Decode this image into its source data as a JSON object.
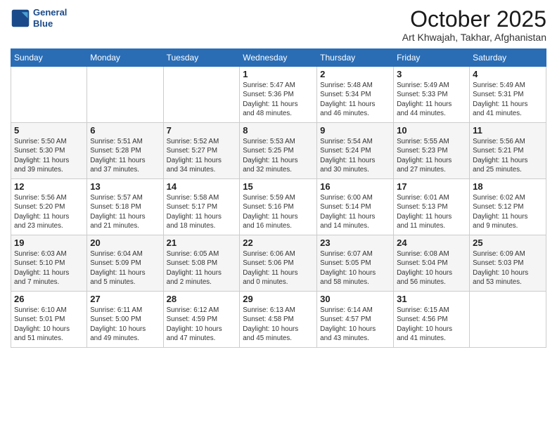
{
  "header": {
    "logo_line1": "General",
    "logo_line2": "Blue",
    "title": "October 2025",
    "location": "Art Khwajah, Takhar, Afghanistan"
  },
  "days_of_week": [
    "Sunday",
    "Monday",
    "Tuesday",
    "Wednesday",
    "Thursday",
    "Friday",
    "Saturday"
  ],
  "weeks": [
    [
      {
        "day": "",
        "info": ""
      },
      {
        "day": "",
        "info": ""
      },
      {
        "day": "",
        "info": ""
      },
      {
        "day": "1",
        "info": "Sunrise: 5:47 AM\nSunset: 5:36 PM\nDaylight: 11 hours\nand 48 minutes."
      },
      {
        "day": "2",
        "info": "Sunrise: 5:48 AM\nSunset: 5:34 PM\nDaylight: 11 hours\nand 46 minutes."
      },
      {
        "day": "3",
        "info": "Sunrise: 5:49 AM\nSunset: 5:33 PM\nDaylight: 11 hours\nand 44 minutes."
      },
      {
        "day": "4",
        "info": "Sunrise: 5:49 AM\nSunset: 5:31 PM\nDaylight: 11 hours\nand 41 minutes."
      }
    ],
    [
      {
        "day": "5",
        "info": "Sunrise: 5:50 AM\nSunset: 5:30 PM\nDaylight: 11 hours\nand 39 minutes."
      },
      {
        "day": "6",
        "info": "Sunrise: 5:51 AM\nSunset: 5:28 PM\nDaylight: 11 hours\nand 37 minutes."
      },
      {
        "day": "7",
        "info": "Sunrise: 5:52 AM\nSunset: 5:27 PM\nDaylight: 11 hours\nand 34 minutes."
      },
      {
        "day": "8",
        "info": "Sunrise: 5:53 AM\nSunset: 5:25 PM\nDaylight: 11 hours\nand 32 minutes."
      },
      {
        "day": "9",
        "info": "Sunrise: 5:54 AM\nSunset: 5:24 PM\nDaylight: 11 hours\nand 30 minutes."
      },
      {
        "day": "10",
        "info": "Sunrise: 5:55 AM\nSunset: 5:23 PM\nDaylight: 11 hours\nand 27 minutes."
      },
      {
        "day": "11",
        "info": "Sunrise: 5:56 AM\nSunset: 5:21 PM\nDaylight: 11 hours\nand 25 minutes."
      }
    ],
    [
      {
        "day": "12",
        "info": "Sunrise: 5:56 AM\nSunset: 5:20 PM\nDaylight: 11 hours\nand 23 minutes."
      },
      {
        "day": "13",
        "info": "Sunrise: 5:57 AM\nSunset: 5:18 PM\nDaylight: 11 hours\nand 21 minutes."
      },
      {
        "day": "14",
        "info": "Sunrise: 5:58 AM\nSunset: 5:17 PM\nDaylight: 11 hours\nand 18 minutes."
      },
      {
        "day": "15",
        "info": "Sunrise: 5:59 AM\nSunset: 5:16 PM\nDaylight: 11 hours\nand 16 minutes."
      },
      {
        "day": "16",
        "info": "Sunrise: 6:00 AM\nSunset: 5:14 PM\nDaylight: 11 hours\nand 14 minutes."
      },
      {
        "day": "17",
        "info": "Sunrise: 6:01 AM\nSunset: 5:13 PM\nDaylight: 11 hours\nand 11 minutes."
      },
      {
        "day": "18",
        "info": "Sunrise: 6:02 AM\nSunset: 5:12 PM\nDaylight: 11 hours\nand 9 minutes."
      }
    ],
    [
      {
        "day": "19",
        "info": "Sunrise: 6:03 AM\nSunset: 5:10 PM\nDaylight: 11 hours\nand 7 minutes."
      },
      {
        "day": "20",
        "info": "Sunrise: 6:04 AM\nSunset: 5:09 PM\nDaylight: 11 hours\nand 5 minutes."
      },
      {
        "day": "21",
        "info": "Sunrise: 6:05 AM\nSunset: 5:08 PM\nDaylight: 11 hours\nand 2 minutes."
      },
      {
        "day": "22",
        "info": "Sunrise: 6:06 AM\nSunset: 5:06 PM\nDaylight: 11 hours\nand 0 minutes."
      },
      {
        "day": "23",
        "info": "Sunrise: 6:07 AM\nSunset: 5:05 PM\nDaylight: 10 hours\nand 58 minutes."
      },
      {
        "day": "24",
        "info": "Sunrise: 6:08 AM\nSunset: 5:04 PM\nDaylight: 10 hours\nand 56 minutes."
      },
      {
        "day": "25",
        "info": "Sunrise: 6:09 AM\nSunset: 5:03 PM\nDaylight: 10 hours\nand 53 minutes."
      }
    ],
    [
      {
        "day": "26",
        "info": "Sunrise: 6:10 AM\nSunset: 5:01 PM\nDaylight: 10 hours\nand 51 minutes."
      },
      {
        "day": "27",
        "info": "Sunrise: 6:11 AM\nSunset: 5:00 PM\nDaylight: 10 hours\nand 49 minutes."
      },
      {
        "day": "28",
        "info": "Sunrise: 6:12 AM\nSunset: 4:59 PM\nDaylight: 10 hours\nand 47 minutes."
      },
      {
        "day": "29",
        "info": "Sunrise: 6:13 AM\nSunset: 4:58 PM\nDaylight: 10 hours\nand 45 minutes."
      },
      {
        "day": "30",
        "info": "Sunrise: 6:14 AM\nSunset: 4:57 PM\nDaylight: 10 hours\nand 43 minutes."
      },
      {
        "day": "31",
        "info": "Sunrise: 6:15 AM\nSunset: 4:56 PM\nDaylight: 10 hours\nand 41 minutes."
      },
      {
        "day": "",
        "info": ""
      }
    ]
  ]
}
